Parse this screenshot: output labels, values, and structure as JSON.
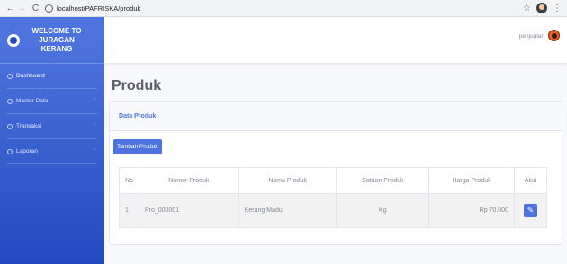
{
  "browser": {
    "back_icon": "arrow-left-icon",
    "forward_icon": "arrow-right-icon",
    "reload_icon": "reload-icon",
    "url": "localhost/PAFRISKA/produk"
  },
  "brand": {
    "line1": "WELCOME TO",
    "line2": "JURAGAN",
    "line3": "KERANG"
  },
  "sidebar": {
    "items": [
      {
        "label": "Dashboard",
        "icon": "dashboard-icon",
        "has_chevron": false
      },
      {
        "label": "Master Data",
        "icon": "folder-icon",
        "has_chevron": true
      },
      {
        "label": "Transaksi",
        "icon": "transaction-icon",
        "has_chevron": true
      },
      {
        "label": "Laporan",
        "icon": "report-icon",
        "has_chevron": true
      }
    ],
    "chevron": "›"
  },
  "topbar": {
    "user_name": "penjualan"
  },
  "page": {
    "title": "Produk"
  },
  "card": {
    "title": "Data Produk",
    "add_button": "Tambah Produk"
  },
  "table": {
    "columns": [
      "No",
      "Nomor Produk",
      "Nama Produk",
      "Satuan Produk",
      "Harga Produk",
      "Aksi"
    ],
    "rows": [
      [
        "1",
        "Pro_000001",
        "Kerang Madu",
        "Kg",
        "Rp 70.000"
      ]
    ]
  },
  "colors": {
    "primary": "#4e73df",
    "sidebar_bottom": "#224abe",
    "page_bg": "#f8f9fc"
  }
}
